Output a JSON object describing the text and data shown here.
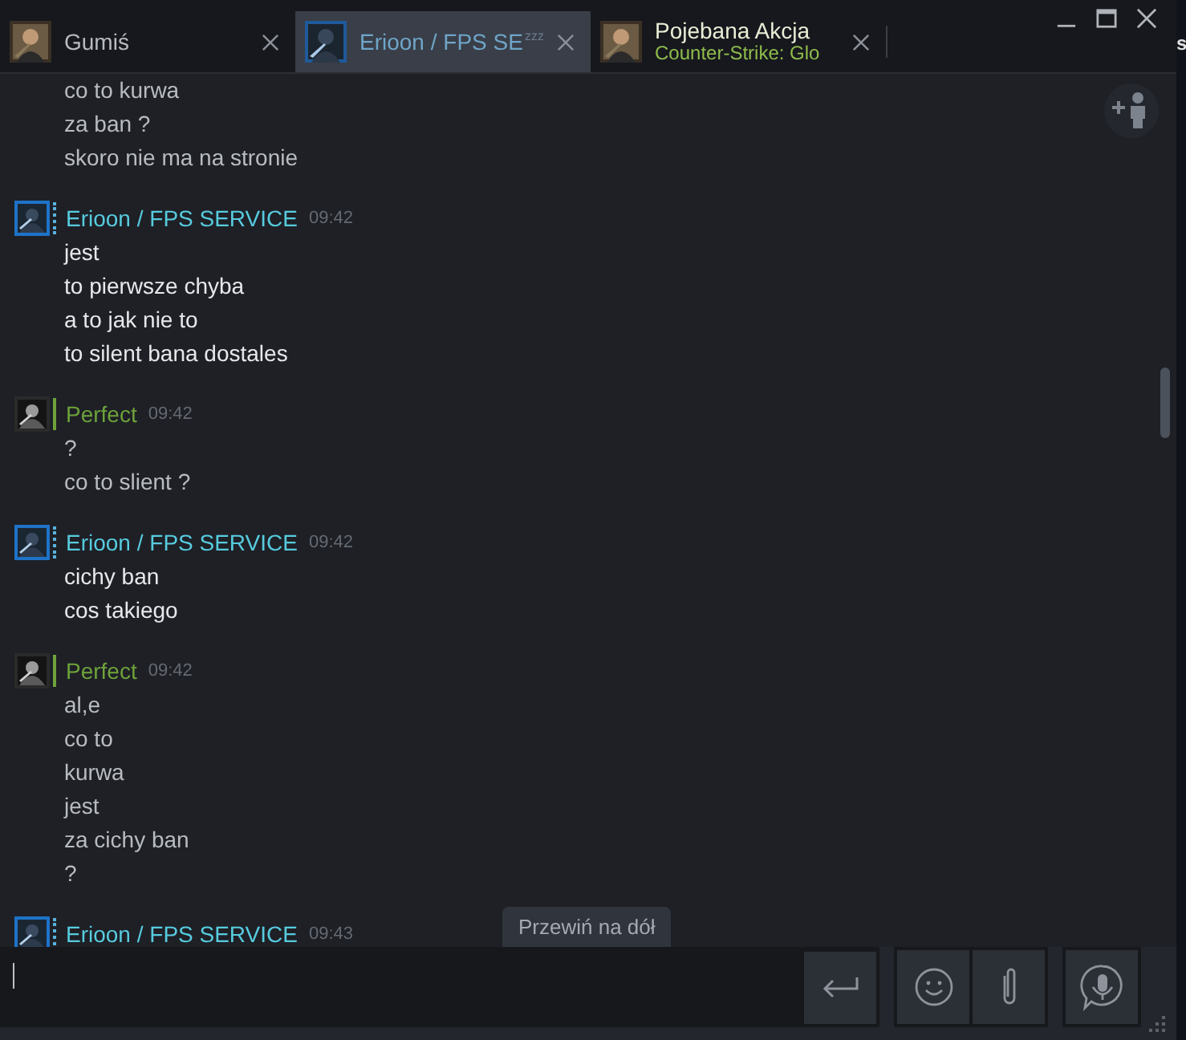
{
  "tabs": [
    {
      "name": "Gumiś",
      "selected": false
    },
    {
      "name": "Erioon / FPS SE",
      "away_mark": "zzz",
      "selected": true
    },
    {
      "name": "Pojebana Akcja",
      "game": "Counter-Strike: Glo",
      "selected": false
    }
  ],
  "messages": [
    {
      "kind": "self",
      "lines": [
        "co to kurwa",
        "za ban ?",
        "skoro nie ma na stronie"
      ]
    },
    {
      "kind": "friend",
      "sender": "Erioon / FPS SERVICE",
      "time": "09:42",
      "lines": [
        "jest",
        "to pierwsze chyba",
        "a to jak nie to",
        "to silent bana dostales"
      ]
    },
    {
      "kind": "self",
      "sender": "Perfect",
      "time": "09:42",
      "lines": [
        "?",
        "co to slient ?"
      ]
    },
    {
      "kind": "friend",
      "sender": "Erioon / FPS SERVICE",
      "time": "09:42",
      "lines": [
        "cichy ban",
        "cos takiego"
      ]
    },
    {
      "kind": "self",
      "sender": "Perfect",
      "time": "09:42",
      "lines": [
        "al,e",
        "co to",
        "kurwa",
        "jest",
        "za cichy ban",
        "?"
      ]
    },
    {
      "kind": "friend",
      "sender": "Erioon / FPS SERVICE",
      "time": "09:43"
    }
  ],
  "scroll_button": "Przewiń na dół",
  "edge_text": "s"
}
